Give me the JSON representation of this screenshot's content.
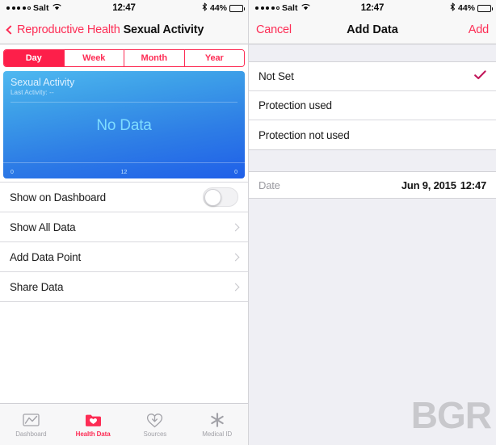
{
  "status_bar": {
    "carrier": "Salt",
    "signal_dots_filled": 4,
    "signal_dots_total": 5,
    "wifi_icon": "wifi-icon",
    "time": "12:47",
    "bluetooth_icon": "bluetooth-icon",
    "battery_percent": "44%",
    "battery_level": 44
  },
  "left_screen": {
    "nav": {
      "back_icon": "chevron-left-icon",
      "back_label": "Reproductive Health",
      "title": "Sexual Activity"
    },
    "segmented": {
      "options": [
        "Day",
        "Week",
        "Month",
        "Year"
      ],
      "selected": "Day",
      "selected_color": "#fd1f4a",
      "tint": "#fd2d55"
    },
    "chart": {
      "title": "Sexual Activity",
      "subtitle": "Last Activity: --",
      "empty_message": "No Data",
      "axis_ticks": [
        "0",
        "12",
        "0"
      ],
      "gradient_from": "#4fb8f0",
      "gradient_to": "#1f5fe8",
      "empty_message_color": "#7fdcff"
    },
    "rows": [
      {
        "label": "Show on Dashboard",
        "control": "switch",
        "switch_on": false
      },
      {
        "label": "Show All Data",
        "control": "chevron"
      },
      {
        "label": "Add Data Point",
        "control": "chevron"
      },
      {
        "label": "Share Data",
        "control": "chevron"
      }
    ],
    "tabbar": {
      "tabs": [
        {
          "label": "Dashboard",
          "icon": "dashboard-chart-icon",
          "active": false
        },
        {
          "label": "Health Data",
          "icon": "health-data-folder-heart-icon",
          "active": true
        },
        {
          "label": "Sources",
          "icon": "sources-download-heart-icon",
          "active": false
        },
        {
          "label": "Medical ID",
          "icon": "medical-id-star-of-life-icon",
          "active": false
        }
      ],
      "active_color": "#fd2d55",
      "inactive_color": "#a2a2a8"
    }
  },
  "right_screen": {
    "nav": {
      "cancel_label": "Cancel",
      "title": "Add Data",
      "add_label": "Add",
      "tint": "#fd2d55"
    },
    "options": [
      {
        "label": "Not Set",
        "selected": true
      },
      {
        "label": "Protection used",
        "selected": false
      },
      {
        "label": "Protection not used",
        "selected": false
      }
    ],
    "checkmark_icon": "checkmark-icon",
    "checkmark_color": "#c2185b",
    "date_row": {
      "label": "Date",
      "date": "Jun 9, 2015",
      "time": "12:47"
    }
  },
  "watermark": {
    "text": "BGR"
  }
}
